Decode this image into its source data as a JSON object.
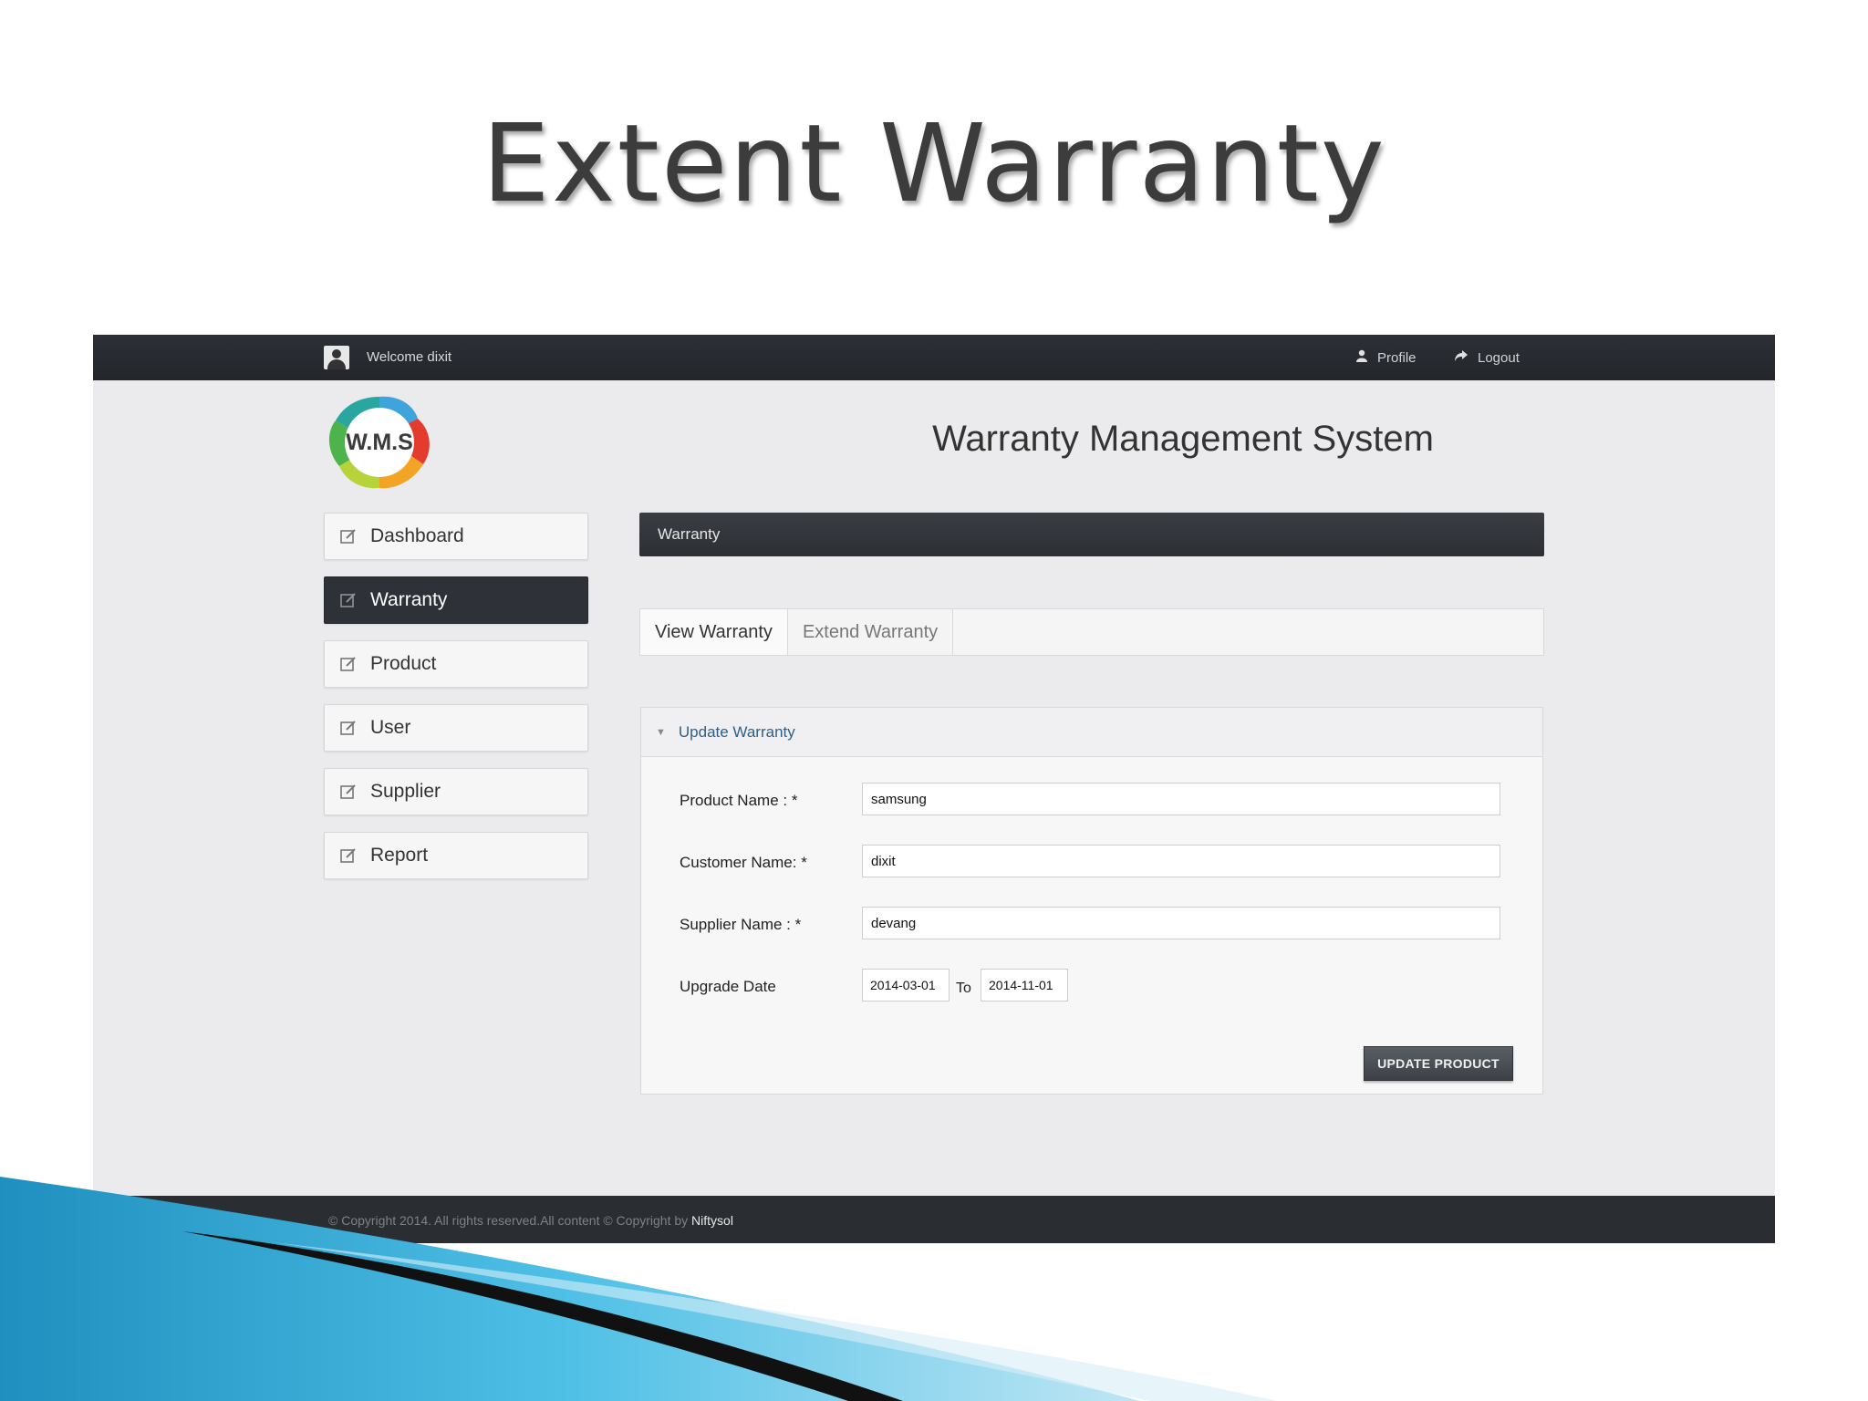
{
  "slide": {
    "title": "Extent Warranty"
  },
  "topbar": {
    "welcome": "Welcome dixit",
    "profile_label": "Profile",
    "logout_label": "Logout"
  },
  "logo": {
    "text": "W.M.S"
  },
  "app_title": "Warranty Management System",
  "sidebar": {
    "items": [
      {
        "label": "Dashboard",
        "active": false
      },
      {
        "label": "Warranty",
        "active": true
      },
      {
        "label": "Product",
        "active": false
      },
      {
        "label": "User",
        "active": false
      },
      {
        "label": "Supplier",
        "active": false
      },
      {
        "label": "Report",
        "active": false
      }
    ]
  },
  "section_bar": {
    "title": "Warranty"
  },
  "tabs": [
    {
      "label": "View Warranty",
      "active": false
    },
    {
      "label": "Extend Warranty",
      "active": true
    }
  ],
  "form": {
    "header": "Update Warranty",
    "product_name_label": "Product Name : *",
    "product_name_value": "samsung",
    "customer_name_label": "Customer Name: *",
    "customer_name_value": "dixit",
    "supplier_name_label": "Supplier Name : *",
    "supplier_name_value": "devang",
    "upgrade_date_label": "Upgrade Date",
    "date_from": "2014-03-01",
    "to_label": "To",
    "date_to": "2014-11-01",
    "submit_label": "UPDATE PRODUCT"
  },
  "footer": {
    "text": "© Copyright 2014. All rights reserved.All content © Copyright by",
    "brand": "Niftysol"
  },
  "colors": {
    "dark_bar": "#2c3035",
    "active_nav": "#2e3238",
    "link_blue": "#2f5f86",
    "swoosh_blue": "#2aa6d3"
  }
}
